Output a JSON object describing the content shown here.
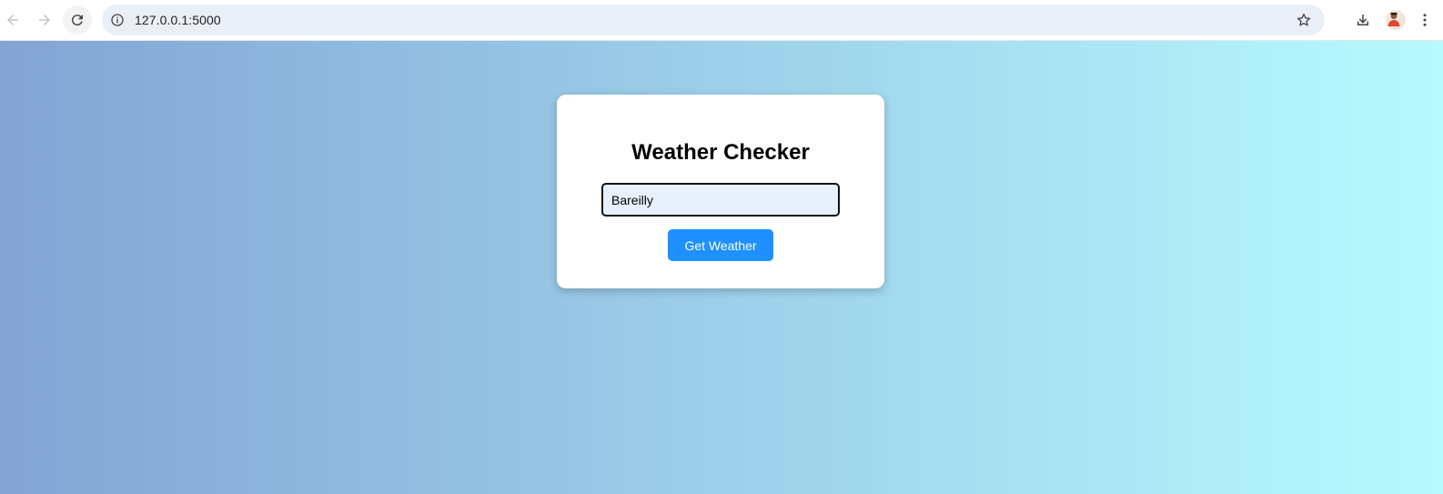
{
  "browser": {
    "url": "127.0.0.1:5000"
  },
  "page": {
    "title": "Weather Checker",
    "city_input": {
      "value": "Bareilly"
    },
    "submit_label": "Get Weather"
  },
  "colors": {
    "gradient_start": "#83a4d4",
    "gradient_end": "#b6fbff",
    "button": "#1e90ff",
    "input_bg": "#e8f0fe"
  }
}
